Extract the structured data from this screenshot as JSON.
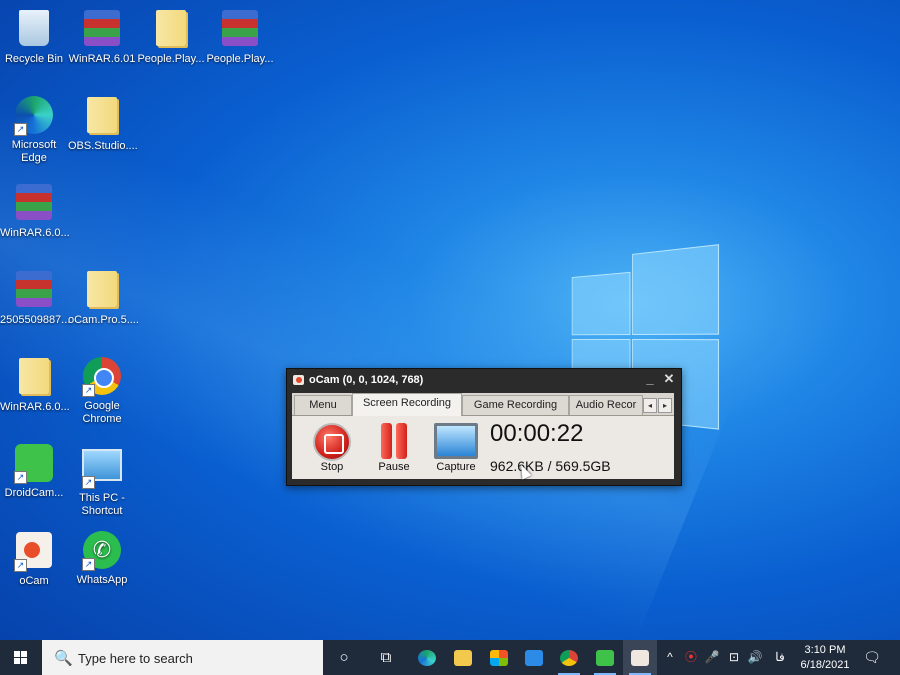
{
  "desktop": {
    "icons": [
      {
        "label": "Recycle Bin"
      },
      {
        "label": "WinRAR.6.01"
      },
      {
        "label": "People.Play..."
      },
      {
        "label": "People.Play..."
      },
      {
        "label": "Microsoft Edge"
      },
      {
        "label": "OBS.Studio...."
      },
      {
        "label": "WinRAR.6.0..."
      },
      {
        "label": "2505509887..."
      },
      {
        "label": "oCam.Pro.5...."
      },
      {
        "label": "WinRAR.6.0..."
      },
      {
        "label": "Google Chrome"
      },
      {
        "label": "DroidCam..."
      },
      {
        "label": "This PC - Shortcut"
      },
      {
        "label": "oCam"
      },
      {
        "label": "WhatsApp"
      }
    ]
  },
  "ocam": {
    "title": "oCam (0, 0, 1024, 768)",
    "minimize": "_",
    "close": "✕",
    "tabs": [
      "Menu",
      "Screen Recording",
      "Game Recording",
      "Audio Recor"
    ],
    "active_tab": "Screen Recording",
    "scroll_left": "◂",
    "scroll_right": "▸",
    "stop_label": "Stop",
    "pause_label": "Pause",
    "capture_label": "Capture",
    "timer": "00:00:22",
    "size": "962.6KB / 569.5GB"
  },
  "taskbar": {
    "search_placeholder": "Type here to search",
    "search_icon": "🔍",
    "cortana_icon": "○",
    "taskview_icon": "⧉",
    "tray": {
      "chevron": "^",
      "record_icon": "⦿",
      "mic_icon": "🎤",
      "network_icon": "⊡",
      "volume_icon": "🔊",
      "lang": "فا",
      "notification_icon": "🗨"
    },
    "time": "3:10 PM",
    "date": "6/18/2021"
  }
}
